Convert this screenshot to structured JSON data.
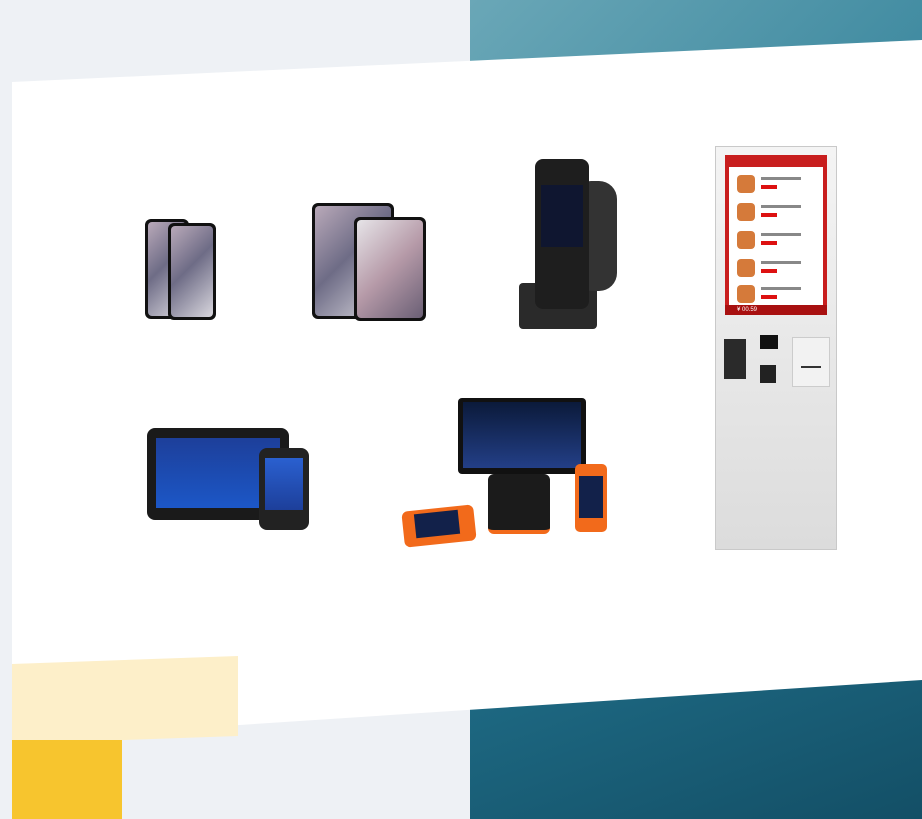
{
  "colors": {
    "teal": "#2f7f98",
    "yellow": "#f7c52e",
    "yellow_light": "#fdefc9",
    "kiosk_red": "#c81e1e"
  },
  "products": [
    {
      "name": "smartphones"
    },
    {
      "name": "tablets"
    },
    {
      "name": "handheld-scanner-with-pistol-grip"
    },
    {
      "name": "rugged-tablet-and-handheld"
    },
    {
      "name": "pos-terminal-set"
    },
    {
      "name": "self-service-kiosk"
    }
  ],
  "kiosk": {
    "price_text": "¥ 00.59"
  }
}
